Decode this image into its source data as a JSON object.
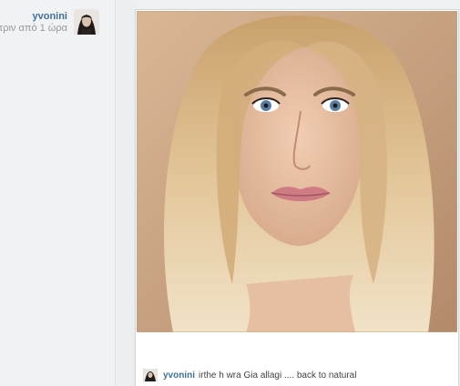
{
  "author": {
    "username": "yvonini",
    "time_ago": "τριν από 1 ώρα",
    "avatar_icon": "avatar-photo"
  },
  "post": {
    "photo_icon": "portrait-photo",
    "caption": {
      "username": "yvonini",
      "text": "irthe h wra Gia allagi .... back to natural"
    }
  },
  "colors": {
    "username": "#3f729b",
    "background": "#eff0f1",
    "card": "#ffffff"
  }
}
